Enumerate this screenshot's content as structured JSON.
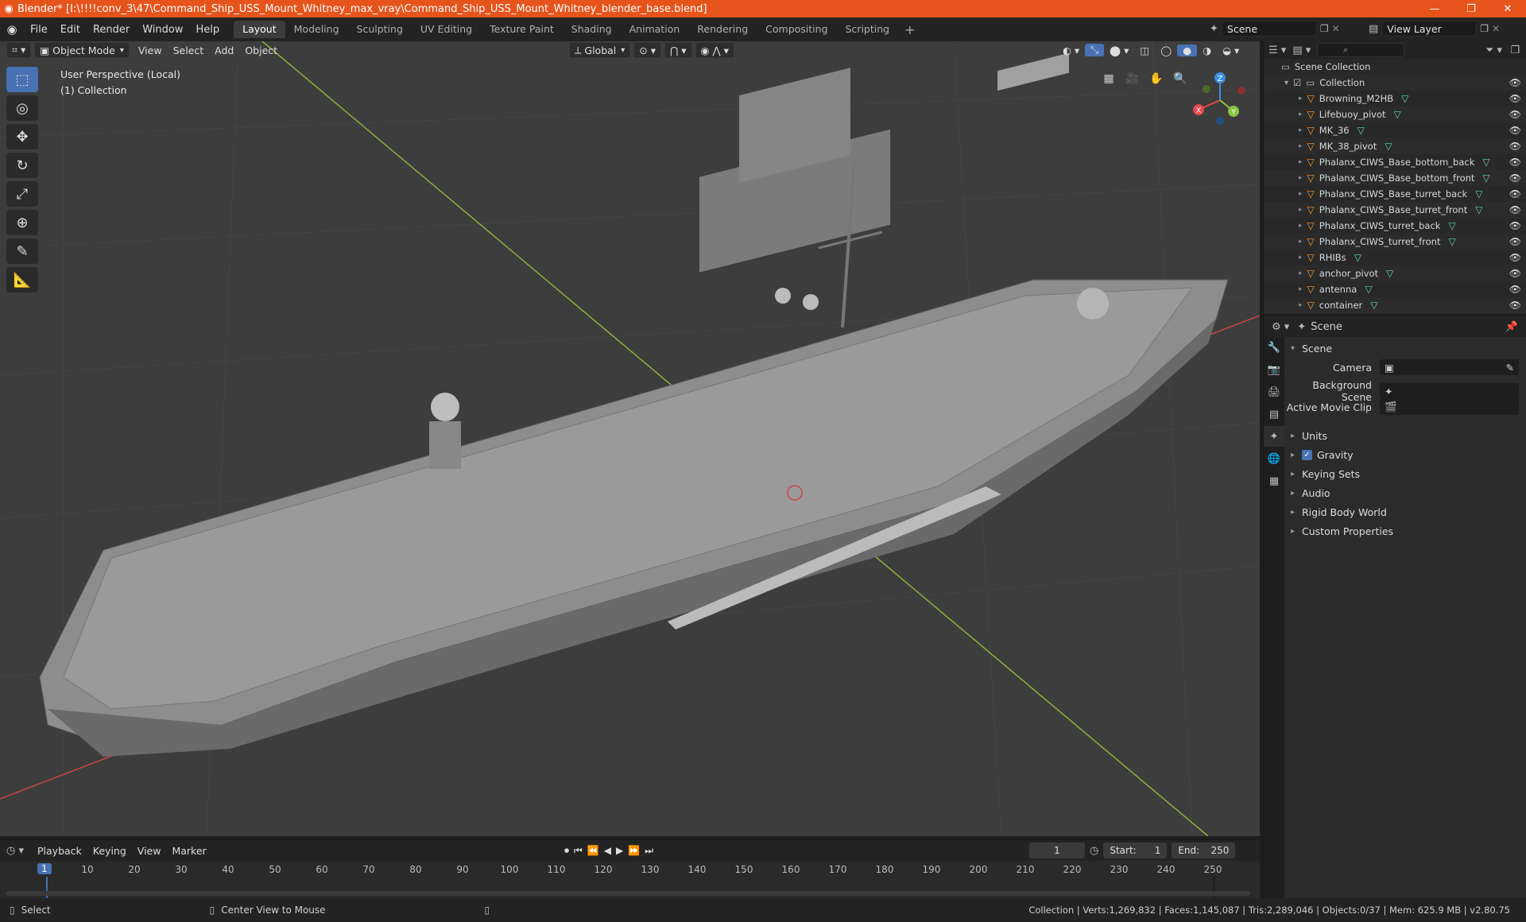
{
  "window": {
    "title": "Blender* [I:\\!!!!conv_3\\47\\Command_Ship_USS_Mount_Whitney_max_vray\\Command_Ship_USS_Mount_Whitney_blender_base.blend]",
    "minimize": "—",
    "maximize": "❐",
    "close": "✕"
  },
  "menu": [
    "File",
    "Edit",
    "Render",
    "Window",
    "Help"
  ],
  "workspaces": {
    "tabs": [
      "Layout",
      "Modeling",
      "Sculpting",
      "UV Editing",
      "Texture Paint",
      "Shading",
      "Animation",
      "Rendering",
      "Compositing",
      "Scripting"
    ],
    "active": "Layout",
    "plus": "+"
  },
  "scene_selector": {
    "value": "Scene"
  },
  "view_layer": {
    "value": "View Layer"
  },
  "viewport": {
    "mode": "Object Mode",
    "menus": [
      "View",
      "Select",
      "Add",
      "Object"
    ],
    "orientation": "Global",
    "info_line1": "User Perspective (Local)",
    "info_line2": "(1) Collection",
    "gizmo": {
      "x": "X",
      "y": "Y",
      "z": "Z",
      "x_color": "#e5484d",
      "y_color": "#8ac33e",
      "z_color": "#3b8ee6"
    }
  },
  "outliner": {
    "search_placeholder": "",
    "root": "Scene Collection",
    "collection": "Collection",
    "items": [
      "Browning_M2HB",
      "Lifebuoy_pivot",
      "MK_36",
      "MK_38_pivot",
      "Phalanx_CIWS_Base_bottom_back",
      "Phalanx_CIWS_Base_bottom_front",
      "Phalanx_CIWS_Base_turret_back",
      "Phalanx_CIWS_Base_turret_front",
      "Phalanx_CIWS_turret_back",
      "Phalanx_CIWS_turret_front",
      "RHIBs",
      "anchor_pivot",
      "antenna",
      "container"
    ]
  },
  "properties": {
    "context": "Scene",
    "panel_title": "Scene",
    "camera_label": "Camera",
    "background_scene_label": "Background Scene",
    "active_movie_clip_label": "Active Movie Clip",
    "sections": [
      "Units",
      "Gravity",
      "Keying Sets",
      "Audio",
      "Rigid Body World",
      "Custom Properties"
    ],
    "gravity_checked": true
  },
  "timeline": {
    "menus": [
      "Playback",
      "Keying",
      "View",
      "Marker"
    ],
    "current_frame": "1",
    "start_label": "Start:",
    "start": "1",
    "end_label": "End:",
    "end": "250",
    "ruler_ticks": [
      "10",
      "20",
      "30",
      "40",
      "50",
      "60",
      "70",
      "80",
      "90",
      "100",
      "110",
      "120",
      "130",
      "140",
      "150",
      "160",
      "170",
      "180",
      "190",
      "200",
      "210",
      "220",
      "230",
      "240",
      "250"
    ]
  },
  "status": {
    "select": "Select",
    "center_view": "Center View to Mouse",
    "stats": "Collection | Verts:1,269,832 | Faces:1,145,087 | Tris:2,289,046 | Objects:0/37 | Mem: 625.9 MB | v2.80.75"
  },
  "colors": {
    "title_bar": "#e6541c",
    "accent": "#4772b3",
    "viewport_bg": "#3d3d3d",
    "x_axis": "#c8454a",
    "y_axis": "#8ab13a"
  }
}
